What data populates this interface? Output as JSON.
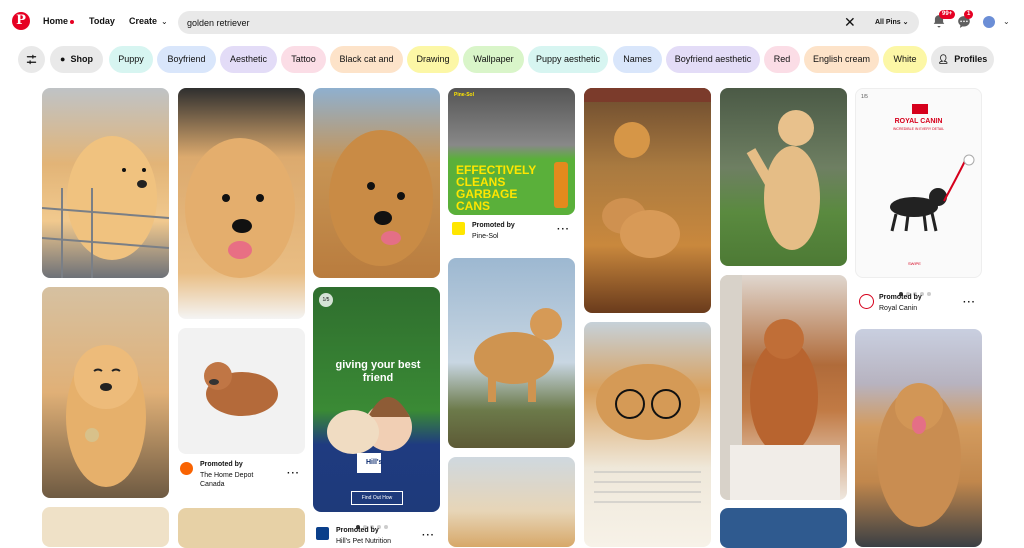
{
  "nav": {
    "home_label": "Home",
    "today_label": "Today",
    "create_label": "Create"
  },
  "search": {
    "value": "golden retriever",
    "scope_label": "All Pins",
    "scope_icon": "chevron-down-icon",
    "clear_icon": "close-icon"
  },
  "header_icons": {
    "notifications_badge": "99+",
    "messages_badge": "1",
    "accent": "#e60023"
  },
  "chips": [
    {
      "label": "",
      "icon": "filter-icon",
      "bg": "#e9e9e9"
    },
    {
      "label": "Shop",
      "icon": "shopping-bag-icon",
      "bg": "#e9e9e9"
    },
    {
      "label": "Puppy",
      "bg": "#d7f5f1"
    },
    {
      "label": "Boyfriend",
      "bg": "#d9e6fb"
    },
    {
      "label": "Aesthetic",
      "bg": "#e3dcf7"
    },
    {
      "label": "Tattoo",
      "bg": "#fbdde6"
    },
    {
      "label": "Black cat and",
      "bg": "#fde3c9"
    },
    {
      "label": "Drawing",
      "bg": "#fcf7a6"
    },
    {
      "label": "Wallpaper",
      "bg": "#d9f5c9"
    },
    {
      "label": "Puppy aesthetic",
      "bg": "#d7f5f1"
    },
    {
      "label": "Names",
      "bg": "#d9e6fb"
    },
    {
      "label": "Boyfriend aesthetic",
      "bg": "#e3dcf7"
    },
    {
      "label": "Red",
      "bg": "#fbdde6"
    },
    {
      "label": "English cream",
      "bg": "#fde3c9"
    },
    {
      "label": "White",
      "bg": "#fcf7a6"
    },
    {
      "label": "Profiles",
      "icon": "person-icon",
      "bg": "#e9e9e9"
    }
  ],
  "ads": {
    "pinesol": {
      "headline": "EFFECTIVELY CLEANS GARBAGE CANS",
      "brand_logo": "Pine-Sol",
      "promoted_label": "Promoted by",
      "advertiser": "Pine-Sol"
    },
    "homedepot": {
      "promoted_label": "Promoted by",
      "advertiser": "The Home Depot Canada"
    },
    "hills": {
      "counter": "1/5",
      "headline": "giving your best friend",
      "brand": "Hill's",
      "cta": "Find Out How",
      "promoted_label": "Promoted by",
      "advertiser": "Hill's Pet Nutrition"
    },
    "royalcanin": {
      "counter": "1/5",
      "brand": "ROYAL CANIN",
      "tagline": "INCREDIBLE IN EVERY DETAIL",
      "cta": "SWIPE",
      "promoted_label": "Promoted by",
      "advertiser": "Royal Canin"
    }
  }
}
